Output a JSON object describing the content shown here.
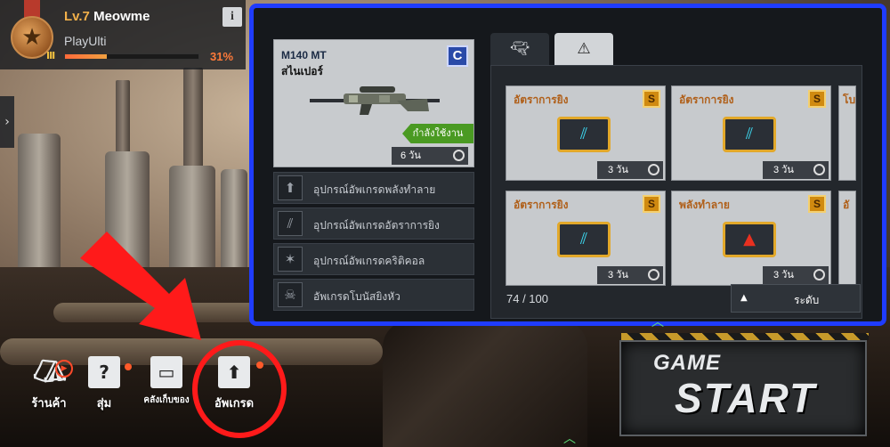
{
  "profile": {
    "level": "Lv.7",
    "name": "Meowme",
    "subtitle": "PlayUlti",
    "xp_percent_label": "31%",
    "xp_fraction": 0.31,
    "info_label": "i"
  },
  "weapon": {
    "name": "M140 MT",
    "class": "สไนเปอร์",
    "grade": "C",
    "equipped_label": "กำลังใช้งาน",
    "duration": "6 วัน"
  },
  "parts": [
    {
      "label": "อุปกรณ์อัพเกรดพลังทำลาย",
      "icon": "upgrade-arrow-icon"
    },
    {
      "label": "อุปกรณ์อัพเกรดอัตราการยิง",
      "icon": "slash-marks-icon"
    },
    {
      "label": "อุปกรณ์อัพเกรดคริติคอล",
      "icon": "star-burst-icon"
    },
    {
      "label": "อัพเกรดโบนัสยิงหัว",
      "icon": "skull-target-icon"
    }
  ],
  "inventory": {
    "slots": [
      {
        "title": "อัตราการยิง",
        "grade": "S",
        "time": "3 วัน",
        "chip": "blue"
      },
      {
        "title": "อัตราการยิง",
        "grade": "S",
        "time": "3 วัน",
        "chip": "blue"
      },
      {
        "title": "อัตราการยิง",
        "grade": "S",
        "time": "3 วัน",
        "chip": "blue"
      },
      {
        "title": "พลังทำลาย",
        "grade": "S",
        "time": "3 วัน",
        "chip": "red"
      }
    ],
    "edge_labels": [
      "โบ",
      "อั"
    ],
    "count": "74 / 100",
    "sort_label": "ระดับ"
  },
  "menu": {
    "shop": "ร้านค้า",
    "random": "สุ่ม",
    "storage": "คลังเก็บของ",
    "upgrade": "อัพเกรด"
  },
  "game_start": {
    "line1": "GAME",
    "line2": "START"
  },
  "colors": {
    "highlight_frame": "#1f3cff",
    "annotation_red": "#ff1a1a",
    "equipped_green": "#4a9a22",
    "grade_gold": "#d08a10"
  }
}
